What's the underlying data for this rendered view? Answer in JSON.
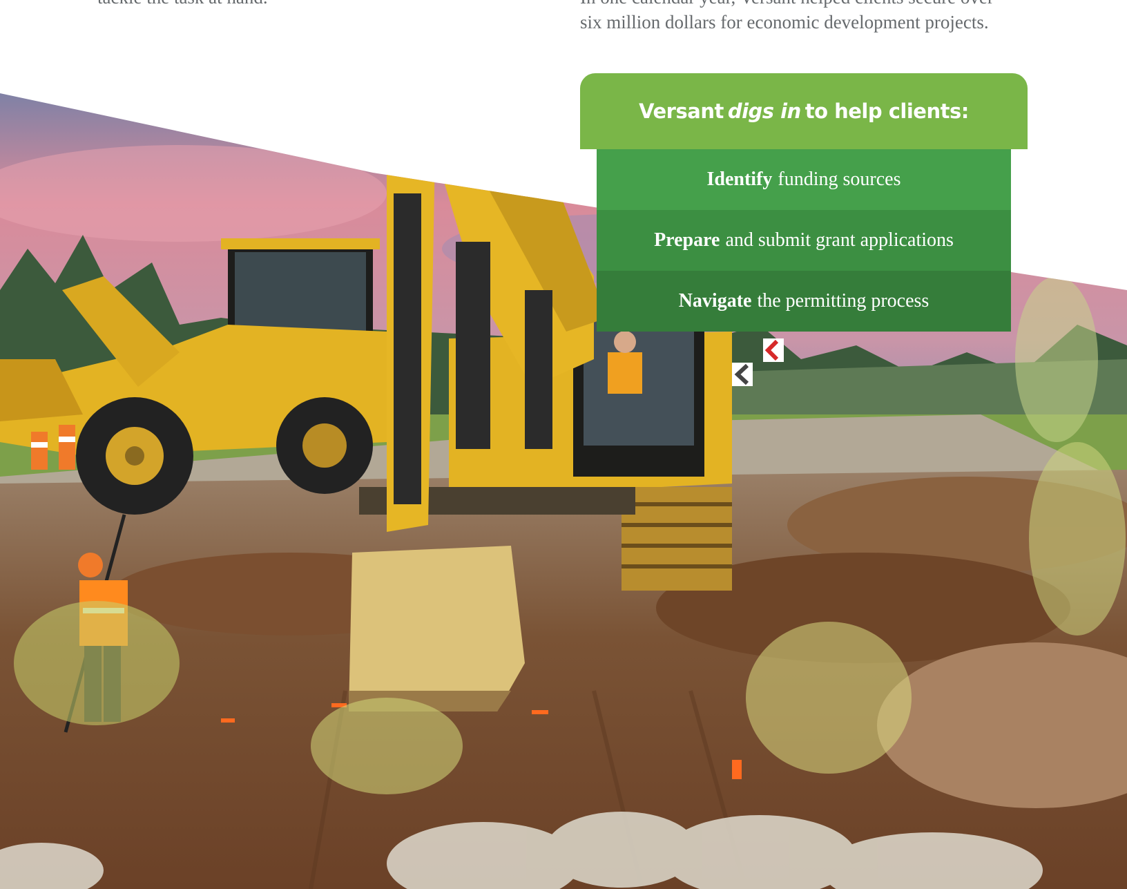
{
  "intro_left": {
    "fragment": "tackle the task at hand."
  },
  "intro_right": {
    "line1": "In one calendar year, Versant helped clients secure over",
    "line2": "six million dollars for economic development projects."
  },
  "callout": {
    "title_pre": "Versant",
    "title_emph": "digs in",
    "title_post": "to help clients:",
    "items": [
      {
        "bold": "Identify",
        "rest": "funding sources"
      },
      {
        "bold": "Prepare",
        "rest": "and submit grant applications"
      },
      {
        "bold": "Navigate",
        "rest": "the permitting process"
      }
    ]
  },
  "colors": {
    "header_green": "#7ab648",
    "row1_green": "#45a04b",
    "row2_green": "#3c8f42",
    "row3_green": "#357d3a",
    "machine_yellow": "#e3b323"
  }
}
